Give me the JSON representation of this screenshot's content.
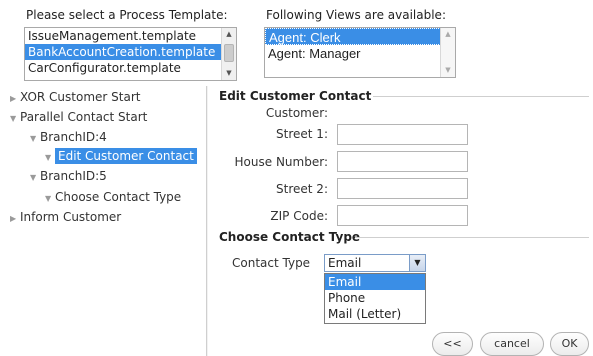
{
  "templates": {
    "label": "Please select a Process Template:",
    "items": [
      {
        "label": "IssueManagement.template",
        "selected": false
      },
      {
        "label": "BankAccountCreation.template",
        "selected": true
      },
      {
        "label": "CarConfigurator.template",
        "selected": false
      }
    ]
  },
  "views": {
    "label": "Following Views are available:",
    "items": [
      {
        "label": "Agent: Clerk",
        "selected": true
      },
      {
        "label": "Agent: Manager",
        "selected": false
      }
    ]
  },
  "tree": {
    "nodes": [
      {
        "label": "XOR Customer Start",
        "expanded": false
      },
      {
        "label": "Parallel Contact Start",
        "expanded": true
      },
      {
        "label": "BranchID:4",
        "expanded": true
      },
      {
        "label": "Edit Customer Contact",
        "expanded": true,
        "selected": true
      },
      {
        "label": "BranchID:5",
        "expanded": true
      },
      {
        "label": "Choose Contact Type",
        "expanded": true
      },
      {
        "label": "Inform Customer",
        "expanded": false
      }
    ]
  },
  "form": {
    "section1_title": "Edit Customer Contact",
    "customer_label": "Customer:",
    "street1_label": "Street 1:",
    "street1_value": "",
    "house_number_label": "House Number:",
    "house_number_value": "",
    "street2_label": "Street 2:",
    "street2_value": "",
    "zip_label": "ZIP Code:",
    "zip_value": "",
    "section2_title": "Choose Contact Type",
    "contact_type_label": "Contact Type",
    "contact_type_value": "Email",
    "contact_type_options": [
      {
        "label": "Email",
        "selected": true
      },
      {
        "label": "Phone",
        "selected": false
      },
      {
        "label": "Mail (Letter)",
        "selected": false
      }
    ]
  },
  "buttons": {
    "back": "<<",
    "cancel": "cancel",
    "ok": "OK"
  },
  "colors": {
    "selection": "#3a8ee6"
  }
}
